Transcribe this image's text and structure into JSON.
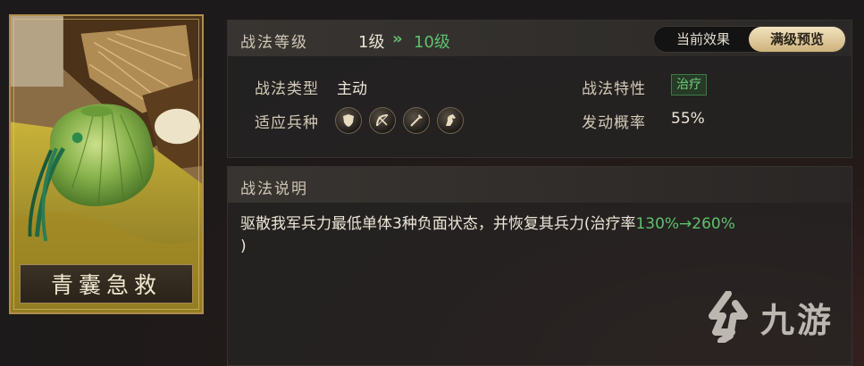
{
  "card": {
    "name": "青囊急救"
  },
  "level": {
    "label": "战法等级",
    "current": "1级",
    "arrow": "»",
    "max": "10级"
  },
  "toggle": {
    "current_label": "当前效果",
    "full_label": "满级预览"
  },
  "stats": {
    "type_label": "战法类型",
    "type_value": "主动",
    "trait_label": "战法特性",
    "trait_value": "治疗",
    "troops_label": "适应兵种",
    "troop_icons": [
      "shield-icon",
      "bow-icon",
      "spear-icon",
      "horse-icon"
    ],
    "chance_label": "发动概率",
    "chance_value": "55%"
  },
  "description": {
    "title": "战法说明",
    "text_before": "驱散我军兵力最低单体3种负面状态，并恢复其兵力(治疗率",
    "text_green": "130%→260%",
    "text_after": ")"
  },
  "watermark": {
    "text": "九游"
  },
  "colors": {
    "accent_green": "#5fc06d",
    "gold": "#cdb27c",
    "background": "#1c1a1a"
  }
}
